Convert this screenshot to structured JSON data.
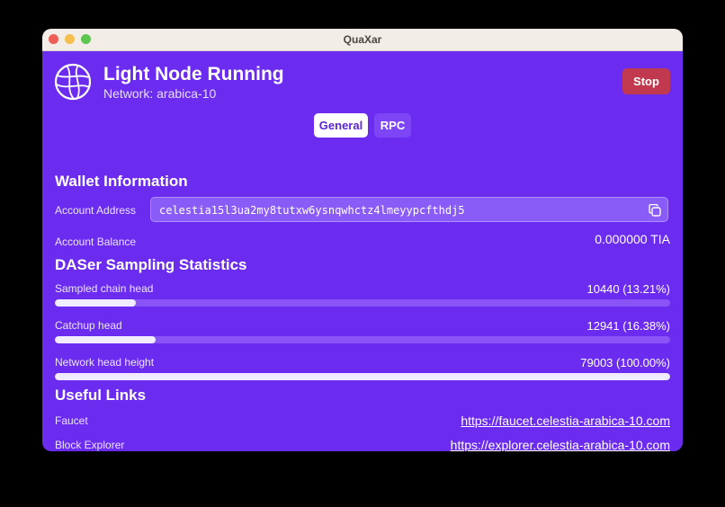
{
  "window": {
    "title": "QuaXar"
  },
  "header": {
    "title": "Light Node Running",
    "network": "Network: arabica-10",
    "stop_label": "Stop"
  },
  "tabs": [
    {
      "label": "General",
      "selected": true
    },
    {
      "label": "RPC",
      "selected": false
    }
  ],
  "wallet": {
    "section_title": "Wallet Information",
    "address_label": "Account Address",
    "address": "celestia15l3ua2my8tutxw6ysnqwhctz4lmeyypcfthdj5",
    "balance_label": "Account Balance",
    "balance": "0.000000 TIA"
  },
  "daser": {
    "section_title": "DASer Sampling Statistics",
    "stats": [
      {
        "label": "Sampled chain head",
        "value": "10440 (13.21%)",
        "fraction": 0.1321
      },
      {
        "label": "Catchup head",
        "value": "12941 (16.38%)",
        "fraction": 0.1638
      },
      {
        "label": "Network head height",
        "value": "79003 (100.00%)",
        "fraction": 1.0
      }
    ]
  },
  "links": {
    "section_title": "Useful Links",
    "items": [
      {
        "label": "Faucet",
        "url": "https://faucet.celestia-arabica-10.com"
      },
      {
        "label": "Block Explorer",
        "url": "https://explorer.celestia-arabica-10.com"
      }
    ]
  },
  "colors": {
    "background": "#6b2cf0",
    "stop_button": "#c0394e",
    "bar_fill": "#f1ecff",
    "bar_track": "#8953f5"
  },
  "icons": {
    "logo": "network-globe-icon",
    "copy": "copy-icon"
  }
}
